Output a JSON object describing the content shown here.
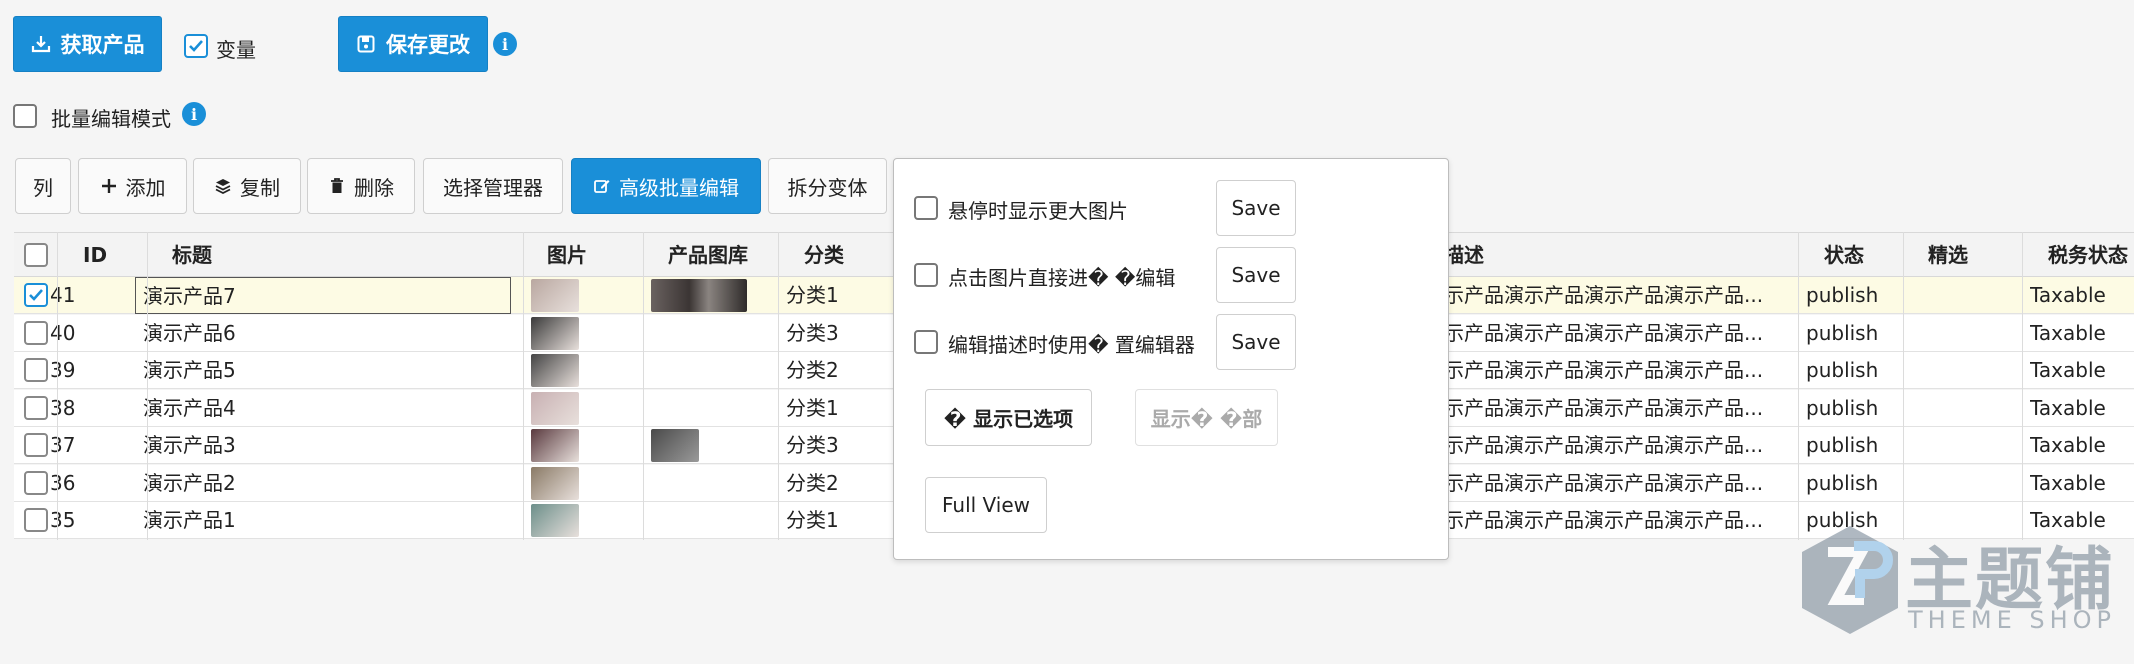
{
  "top": {
    "fetch_label": "获取产品",
    "variant_label": "变量",
    "save_label": "保存更改",
    "bulk_mode_label": "批量编辑模式",
    "info_glyph": "i"
  },
  "toolbar": {
    "columns": "列",
    "add": "添加",
    "copy": "复制",
    "delete": "删除",
    "selection_manager": "选择管理器",
    "advanced_bulk_edit": "高级批量编辑",
    "split_variants": "拆分变体"
  },
  "table": {
    "headers": {
      "id": "ID",
      "title": "标题",
      "image": "图片",
      "gallery": "产品图库",
      "category": "分类",
      "description": "描述",
      "status": "状态",
      "featured": "精选",
      "tax_status": "税务状态"
    },
    "rows": [
      {
        "id": "41",
        "title": "演示产品7",
        "category": "分类1",
        "desc": "示产品演示产品演示产品演示产品...",
        "status": "publish",
        "tax": "Taxable",
        "selected": true
      },
      {
        "id": "40",
        "title": "演示产品6",
        "category": "分类3",
        "desc": "示产品演示产品演示产品演示产品...",
        "status": "publish",
        "tax": "Taxable",
        "selected": false
      },
      {
        "id": "39",
        "title": "演示产品5",
        "category": "分类2",
        "desc": "示产品演示产品演示产品演示产品...",
        "status": "publish",
        "tax": "Taxable",
        "selected": false
      },
      {
        "id": "38",
        "title": "演示产品4",
        "category": "分类1",
        "desc": "示产品演示产品演示产品演示产品...",
        "status": "publish",
        "tax": "Taxable",
        "selected": false
      },
      {
        "id": "37",
        "title": "演示产品3",
        "category": "分类3",
        "desc": "示产品演示产品演示产品演示产品...",
        "status": "publish",
        "tax": "Taxable",
        "selected": false
      },
      {
        "id": "36",
        "title": "演示产品2",
        "category": "分类2",
        "desc": "示产品演示产品演示产品演示产品...",
        "status": "publish",
        "tax": "Taxable",
        "selected": false
      },
      {
        "id": "35",
        "title": "演示产品1",
        "category": "分类1",
        "desc": "示产品演示产品演示产品演示产品...",
        "status": "publish",
        "tax": "Taxable",
        "selected": false
      }
    ]
  },
  "popup": {
    "option1": "悬停时显示更大图片",
    "option2": "点击图片直接进� �编辑",
    "option3": "编辑描述时使用� 置编辑器",
    "save": "Save",
    "show_selected": "� 显示已选项",
    "show_all": "显示� �部",
    "full_view": "Full View"
  },
  "watermark": {
    "name": "主题铺",
    "sub": "THEME SHOP"
  },
  "colors": {
    "accent": "#1a8fd8",
    "selected_row": "#fdfbe4"
  }
}
